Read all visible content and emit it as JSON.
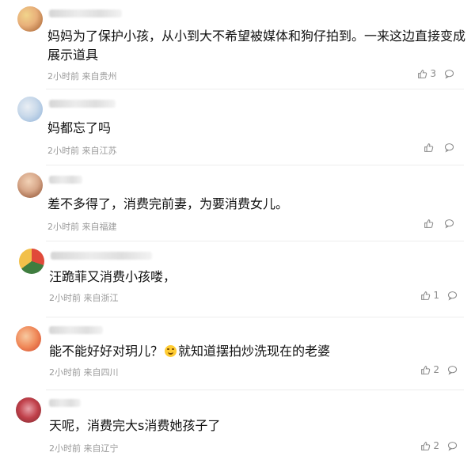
{
  "comments": [
    {
      "text": "妈妈为了保护小孩，从小到大不希望被媒体和狗仔拍到。一来这边直接变成",
      "text_line2": "展示道具",
      "time": "2小时前",
      "location": "来自贵州",
      "likes": "3",
      "avatar_colors": [
        "#e8b07a",
        "#a05a2c",
        "#f1d48b"
      ]
    },
    {
      "text": "妈都忘了吗",
      "time": "2小时前",
      "location": "来自江苏",
      "likes": "",
      "avatar_colors": [
        "#8fb2d9",
        "#c9d9ea",
        "#e9eef4"
      ]
    },
    {
      "text": "差不多得了，消费完前妻，为要消费女儿。",
      "time": "2小时前",
      "location": "来自福建",
      "likes": "",
      "avatar_colors": [
        "#d8a88a",
        "#8a4a2a",
        "#f2d2b6"
      ]
    },
    {
      "text": "汪跪菲又消费小孩喽，",
      "time": "2小时前",
      "location": "来自浙江",
      "likes": "1",
      "avatar_colors": [
        "#e04a3a",
        "#3f7d3f",
        "#f2c04a"
      ]
    },
    {
      "text_before": "能不能好好对玥儿？",
      "text_after": "就知道摆拍炒洗现在的老婆",
      "emoji": "grin-emoji",
      "time": "2小时前",
      "location": "来自四川",
      "likes": "2",
      "avatar_colors": [
        "#f08a5a",
        "#d0452a",
        "#f7c9a0"
      ]
    },
    {
      "text": "天呢，消费完大s消费她孩子了",
      "time": "2小时前",
      "location": "来自辽宁",
      "likes": "2",
      "avatar_colors": [
        "#c0404a",
        "#e8a0a8",
        "#7a2a30"
      ]
    }
  ],
  "icons": {
    "like": "thumbs-up-icon",
    "reply": "comment-bubble-icon"
  }
}
